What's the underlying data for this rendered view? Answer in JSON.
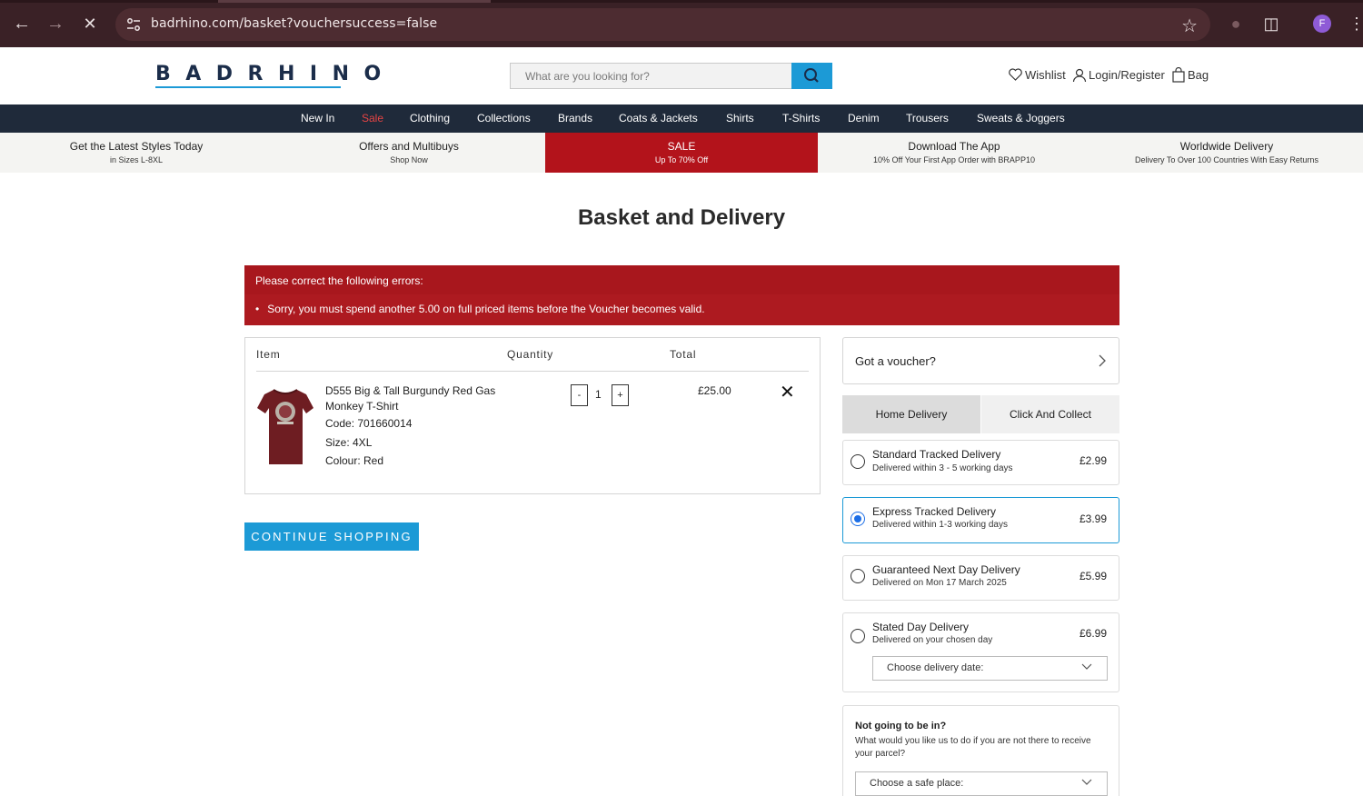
{
  "browser": {
    "url": "badrhino.com/basket?vouchersuccess=false",
    "profile_initial": "F"
  },
  "header": {
    "logo": "BADRHINO",
    "search_placeholder": "What are you looking for?",
    "wishlist": "Wishlist",
    "login": "Login/Register",
    "bag": "Bag"
  },
  "nav": {
    "items": [
      "New In",
      "Sale",
      "Clothing",
      "Collections",
      "Brands",
      "Coats & Jackets",
      "Shirts",
      "T-Shirts",
      "Denim",
      "Trousers",
      "Sweats & Joggers"
    ]
  },
  "promo": [
    {
      "title": "Get the Latest Styles Today",
      "sub": "in Sizes L-8XL"
    },
    {
      "title": "Offers and Multibuys",
      "sub": "Shop Now"
    },
    {
      "title": "SALE",
      "sub": "Up To 70% Off"
    },
    {
      "title": "Download The App",
      "sub": "10% Off Your First App Order with BRAPP10"
    },
    {
      "title": "Worldwide Delivery",
      "sub": "Delivery To Over 100 Countries With Easy Returns"
    }
  ],
  "page_title": "Basket and Delivery",
  "errors": {
    "heading": "Please correct the following errors:",
    "message": "Sorry, you must spend another 5.00 on full priced items before the Voucher becomes valid."
  },
  "basket": {
    "col_item": "Item",
    "col_quantity": "Quantity",
    "col_total": "Total",
    "product": {
      "name": "D555 Big & Tall Burgundy Red Gas Monkey T-Shirt",
      "code": "Code: 701660014",
      "size": "Size: 4XL",
      "colour": "Colour: Red",
      "quantity": "1",
      "total": "£25.00",
      "minus": "-",
      "plus": "+"
    }
  },
  "continue_label": "CONTINUE SHOPPING",
  "voucher_label": "Got a voucher?",
  "delivery_tabs": {
    "home": "Home Delivery",
    "collect": "Click And Collect"
  },
  "delivery_options": [
    {
      "name": "Standard Tracked Delivery",
      "sub": "Delivered within 3 - 5 working days",
      "price": "£2.99",
      "selected": false
    },
    {
      "name": "Express Tracked Delivery",
      "sub": "Delivered within 1-3 working days",
      "price": "£3.99",
      "selected": true
    },
    {
      "name": "Guaranteed Next Day Delivery",
      "sub": "Delivered on Mon 17 March 2025",
      "price": "£5.99",
      "selected": false
    },
    {
      "name": "Stated Day Delivery",
      "sub": "Delivered on your chosen day",
      "price": "£6.99",
      "selected": false
    }
  ],
  "delivery_date_placeholder": "Choose delivery date:",
  "safe_place": {
    "question": "Not going to be in?",
    "description": "What would you like us to do if you are not there to receive your parcel?",
    "placeholder": "Choose a safe place:"
  },
  "colors": {
    "accent": "#1c9ad6",
    "error": "#ad1a20",
    "nav_bg": "#1f2a3a",
    "sale_red": "#b3131b"
  }
}
